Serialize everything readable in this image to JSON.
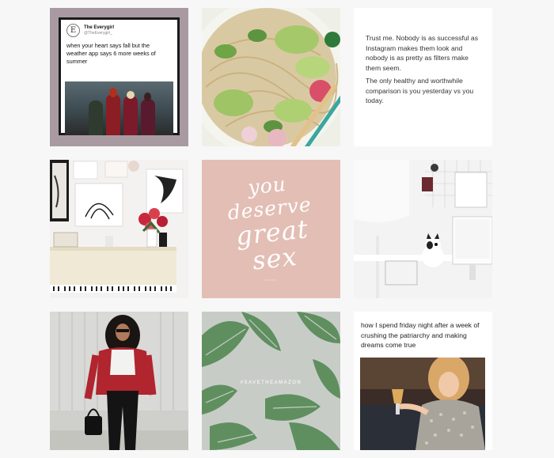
{
  "grid": {
    "tiles": [
      {
        "kind": "tweet-screenshot",
        "account_name": "The Everygirl",
        "account_handle": "@TheEverygirl_",
        "logo_letter": "E",
        "tweet_text": "when your heart says fall but the weather app says 6 more weeks of summer",
        "colors": {
          "background": "#a89aa0"
        }
      },
      {
        "kind": "photo",
        "subject": "noodle bowl with avocado and radish",
        "colors": {
          "background": "#eef0e8"
        }
      },
      {
        "kind": "quote",
        "paragraphs": [
          "Trust me. Nobody is as successful as Instagram makes them look and nobody is as pretty as filters make them seem.",
          "The only healthy and worthwhile comparison is you yesterday vs you today."
        ]
      },
      {
        "kind": "photo",
        "subject": "white living room with piano, art prints and red flowers"
      },
      {
        "kind": "typography",
        "lines": [
          "you",
          "deserve",
          "great",
          "sex"
        ],
        "colors": {
          "background": "#e3beb5",
          "text": "#ffffff"
        }
      },
      {
        "kind": "photo",
        "subject": "white desk with lamp, computer and french bulldog"
      },
      {
        "kind": "photo",
        "subject": "woman in red cardigan against white wooden wall"
      },
      {
        "kind": "graphic",
        "hashtag": "#SAVETHEAMAZON",
        "colors": {
          "background": "#c8ccc7",
          "leaf": "#5f8f5f"
        }
      },
      {
        "kind": "tweet-photo",
        "caption": "how I spend friday night after a week of crushing the patriarchy and making dreams come true",
        "subject": "woman in sequin dress holding a glass"
      }
    ]
  }
}
